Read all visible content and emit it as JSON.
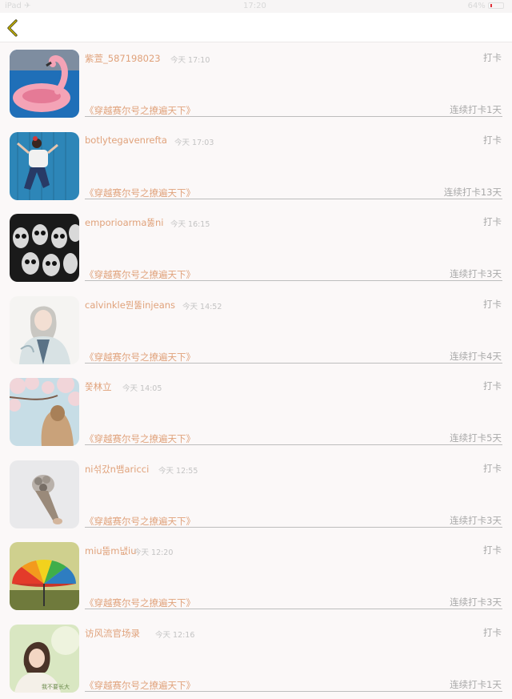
{
  "status_bar": {
    "left": "iPad ✈",
    "time": "17:20",
    "right": "64%"
  },
  "nav": {
    "back_icon": "chevron-left-icon",
    "accent": "#b9a000"
  },
  "colors": {
    "username": "#e0a27b",
    "muted": "#a9a9a9",
    "time": "#c3c3c3"
  },
  "feed": {
    "items": [
      {
        "username": "紫萱_587198023",
        "time": "今天 17:10",
        "checkin": "打卡",
        "book": "《穿越赛尔号之撩遍天下》",
        "streak": "连续打卡1天",
        "avatar": "flamingo-float-photo"
      },
      {
        "username": "botlytegavenrefta",
        "time": "今天 17:03",
        "checkin": "打卡",
        "book": "《穿越赛尔号之撩遍天下》",
        "streak": "连续打卡13天",
        "avatar": "girl-against-blue-wall-photo"
      },
      {
        "username": "emporioarma뚫ni",
        "time": "今天 16:15",
        "checkin": "打卡",
        "book": "《穿越赛尔号之撩遍天下》",
        "streak": "连续打卡3天",
        "avatar": "skull-masks-crowd-photo"
      },
      {
        "username": "calvinkle뭔뚫injeans",
        "time": "今天 14:52",
        "checkin": "打卡",
        "book": "《穿越赛尔号之撩遍天下》",
        "streak": "连续打卡4天",
        "avatar": "anime-girl-illustration"
      },
      {
        "username": "쫓林立",
        "time": "今天 14:05",
        "checkin": "打卡",
        "book": "《穿越赛尔号之撩遍天下》",
        "streak": "连续打卡5天",
        "avatar": "girl-cherry-blossoms-photo"
      },
      {
        "username": "ni섞갔n뱀aricci",
        "time": "今天 12:55",
        "checkin": "打卡",
        "book": "《穿越赛尔号之撩遍天下》",
        "streak": "连续打卡3天",
        "avatar": "flower-bouquet-photo"
      },
      {
        "username": "miu뜲m냆iu",
        "time": "今天 12:20",
        "checkin": "打卡",
        "book": "《穿越赛尔号之撩遍天下》",
        "streak": "连续打卡3天",
        "avatar": "rainbow-umbrella-photo"
      },
      {
        "username": "访风流官场录",
        "time": "今天 12:16",
        "checkin": "打卡",
        "book": "《穿越赛尔号之撩遍天下》",
        "streak": "连续打卡1天",
        "avatar": "girl-portrait-photo"
      }
    ]
  }
}
